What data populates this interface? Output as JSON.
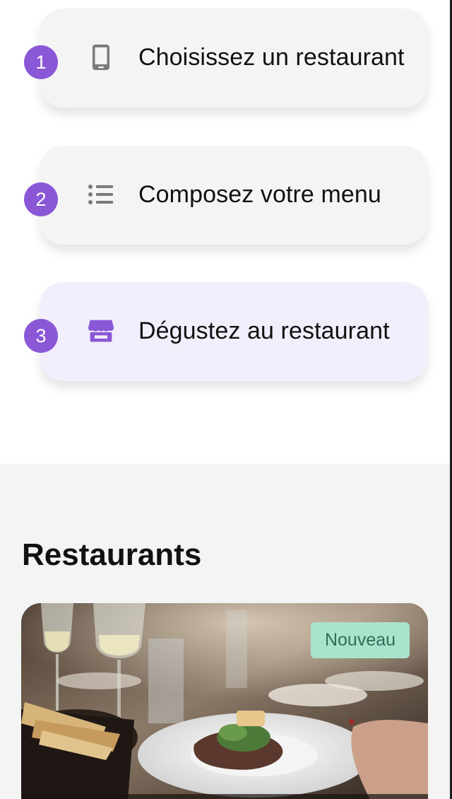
{
  "steps": [
    {
      "number": "1",
      "label": "Choisissez un restaurant",
      "icon": "smartphone-icon",
      "active": false
    },
    {
      "number": "2",
      "label": "Composez votre menu",
      "icon": "list-icon",
      "active": false
    },
    {
      "number": "3",
      "label": "Dégustez au restaurant",
      "icon": "storefront-icon",
      "active": true
    }
  ],
  "restaurants": {
    "title": "Restaurants",
    "cards": [
      {
        "badge": "Nouveau",
        "image": "restaurant-table-photo"
      }
    ]
  },
  "colors": {
    "accent": "#8a58d6",
    "card_bg": "#f4f4f4",
    "active_card_bg": "#f3eefb",
    "badge_bg": "#a8e4cc",
    "badge_text": "#2f6e5a"
  }
}
